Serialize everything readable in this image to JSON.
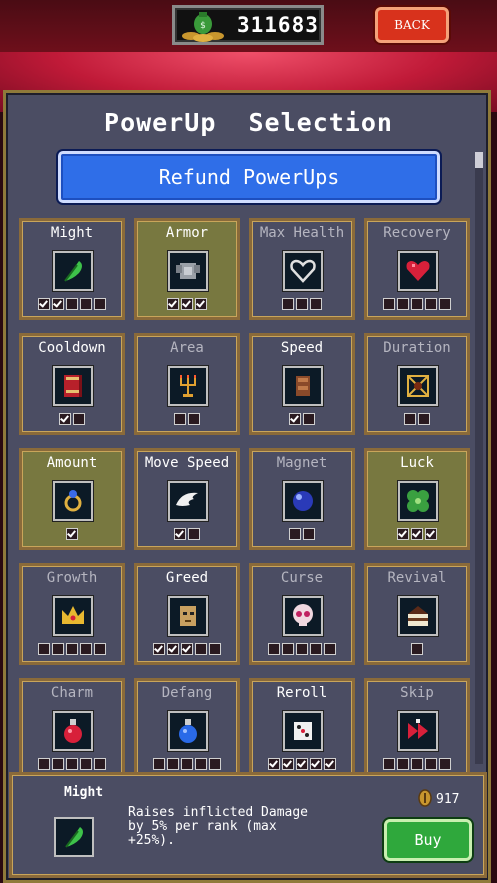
{
  "header": {
    "gold": "311683",
    "back_label": "BACK"
  },
  "title": "PowerUp  Selection",
  "refund_label": "Refund PowerUps",
  "powerups": [
    {
      "name": "Might",
      "icon": "feather-icon",
      "owned": 2,
      "max": 5,
      "selected": false,
      "dim": false
    },
    {
      "name": "Armor",
      "icon": "armor-icon",
      "owned": 3,
      "max": 3,
      "selected": true,
      "dim": false
    },
    {
      "name": "Max Health",
      "icon": "heart-outline-icon",
      "owned": 0,
      "max": 3,
      "selected": false,
      "dim": true
    },
    {
      "name": "Recovery",
      "icon": "heart-icon",
      "owned": 0,
      "max": 5,
      "selected": false,
      "dim": true
    },
    {
      "name": "Cooldown",
      "icon": "book-icon",
      "owned": 1,
      "max": 2,
      "selected": false,
      "dim": false
    },
    {
      "name": "Area",
      "icon": "candelabra-icon",
      "owned": 0,
      "max": 2,
      "selected": false,
      "dim": true
    },
    {
      "name": "Speed",
      "icon": "gauntlet-icon",
      "owned": 1,
      "max": 2,
      "selected": false,
      "dim": false
    },
    {
      "name": "Duration",
      "icon": "spellbinder-icon",
      "owned": 0,
      "max": 2,
      "selected": false,
      "dim": true
    },
    {
      "name": "Amount",
      "icon": "ring-icon",
      "owned": 1,
      "max": 1,
      "selected": true,
      "dim": false
    },
    {
      "name": "Move Speed",
      "icon": "wings-icon",
      "owned": 1,
      "max": 2,
      "selected": false,
      "dim": false
    },
    {
      "name": "Magnet",
      "icon": "orb-icon",
      "owned": 0,
      "max": 2,
      "selected": false,
      "dim": true
    },
    {
      "name": "Luck",
      "icon": "clover-icon",
      "owned": 3,
      "max": 3,
      "selected": true,
      "dim": false
    },
    {
      "name": "Growth",
      "icon": "crown-icon",
      "owned": 0,
      "max": 5,
      "selected": false,
      "dim": true
    },
    {
      "name": "Greed",
      "icon": "mask-icon",
      "owned": 3,
      "max": 5,
      "selected": false,
      "dim": false
    },
    {
      "name": "Curse",
      "icon": "skull-icon",
      "owned": 0,
      "max": 5,
      "selected": false,
      "dim": true
    },
    {
      "name": "Revival",
      "icon": "tiragisu-icon",
      "owned": 0,
      "max": 1,
      "selected": false,
      "dim": true
    },
    {
      "name": "Charm",
      "icon": "red-potion-icon",
      "owned": 0,
      "max": 5,
      "selected": false,
      "dim": true
    },
    {
      "name": "Defang",
      "icon": "blue-potion-icon",
      "owned": 0,
      "max": 5,
      "selected": false,
      "dim": true
    },
    {
      "name": "Reroll",
      "icon": "dice-icon",
      "owned": 5,
      "max": 5,
      "selected": false,
      "dim": false
    },
    {
      "name": "Skip",
      "icon": "skip-icon",
      "owned": 0,
      "max": 5,
      "selected": false,
      "dim": true
    }
  ],
  "detail": {
    "name": "Might",
    "icon": "feather-icon",
    "description": "Raises inflicted Damage\nby 5% per rank (max\n+25%).",
    "price": "917",
    "buy_label": "Buy"
  },
  "colors": {
    "refund": "#2f6ee8",
    "buy": "#2fa83c",
    "back": "#d8321c",
    "selected_card": "#787840",
    "card": "#4b4d63"
  }
}
